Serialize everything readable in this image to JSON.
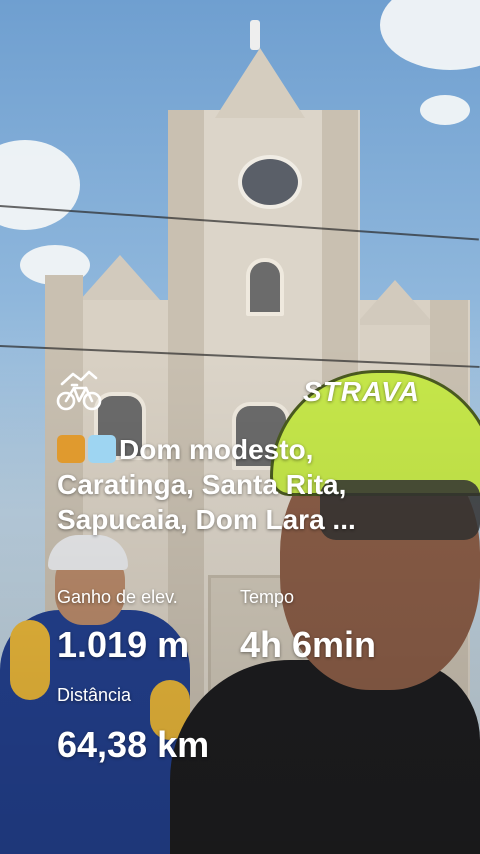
{
  "brand": {
    "name": "STRAVA"
  },
  "activity": {
    "icon": "bike-icon",
    "title": "Dom modesto, Caratinga, Santa Rita, Sapucaia, Dom Lara ...",
    "title_emojis": [
      "cyclist-emoji",
      "dash-emoji"
    ]
  },
  "stats": {
    "elevation": {
      "label": "Ganho de elev.",
      "value": "1.019 m"
    },
    "time": {
      "label": "Tempo",
      "value": "4h 6min"
    },
    "distance": {
      "label": "Distância",
      "value": "64,38 km"
    }
  },
  "colors": {
    "text": "#ffffff",
    "helmet": "#c6e84a",
    "jersey": "#23408e"
  }
}
